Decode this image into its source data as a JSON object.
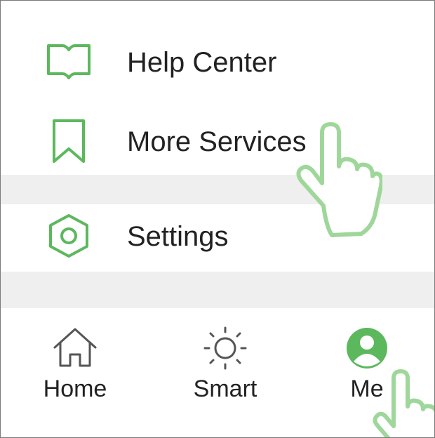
{
  "menu": {
    "help_center": {
      "label": "Help Center",
      "icon": "book-icon"
    },
    "more_services": {
      "label": "More Services",
      "icon": "bookmark-icon"
    },
    "settings": {
      "label": "Settings",
      "icon": "hexagon-settings-icon"
    }
  },
  "tabbar": {
    "home": {
      "label": "Home",
      "icon": "home-icon"
    },
    "smart": {
      "label": "Smart",
      "icon": "sun-icon"
    },
    "me": {
      "label": "Me",
      "icon": "profile-icon",
      "active": true
    }
  },
  "colors": {
    "accent": "#5cb85c",
    "pointer": "#9fd79a",
    "text": "#222222",
    "separator": "#efefef",
    "icon_gray": "#555555"
  },
  "pointers": [
    "tap-hand-icon",
    "tap-hand-icon"
  ]
}
